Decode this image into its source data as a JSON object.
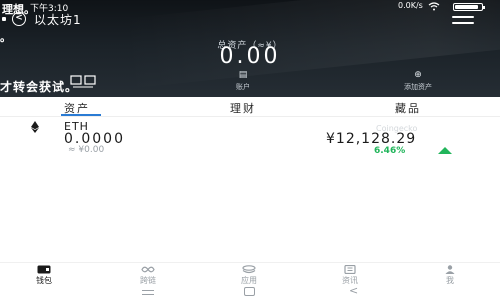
{
  "status_bar": {
    "time": "下午3:10",
    "net_speed": "0.0K/s"
  },
  "overlay_text": {
    "top": "理想。",
    "left": "。",
    "middle": "才转会获试。"
  },
  "header": {
    "wallet_name": "以太坊1",
    "total_assets_label": "总资产（≈¥）",
    "total_assets_value": "0.00"
  },
  "quick_actions": [
    {
      "label": "账户",
      "icon": "account-icon"
    },
    {
      "label": "添加资产",
      "icon": "add-asset-icon"
    }
  ],
  "tabs": [
    {
      "label": "资产",
      "active": true
    },
    {
      "label": "理财",
      "active": false
    },
    {
      "label": "藏品",
      "active": false
    }
  ],
  "tokens": [
    {
      "symbol": "ETH",
      "amount": "0.0000",
      "fiat_value": "≈ ¥0.00",
      "price_source": "Coingecko",
      "price": "¥12,128.29",
      "change": "6.46%",
      "change_color": "#21b55b",
      "icon": "ethereum-icon"
    }
  ],
  "bottom_nav": [
    {
      "label": "钱包",
      "icon": "wallet-icon",
      "active": true
    },
    {
      "label": "跨链",
      "icon": "cross-chain-icon",
      "active": false
    },
    {
      "label": "应用",
      "icon": "apps-icon",
      "active": false
    },
    {
      "label": "资讯",
      "icon": "news-icon",
      "active": false
    },
    {
      "label": "我",
      "icon": "profile-icon",
      "active": false
    }
  ],
  "colors": {
    "accent": "#2a7bd4",
    "positive": "#21b55b",
    "header_dark": "#1b2228"
  }
}
